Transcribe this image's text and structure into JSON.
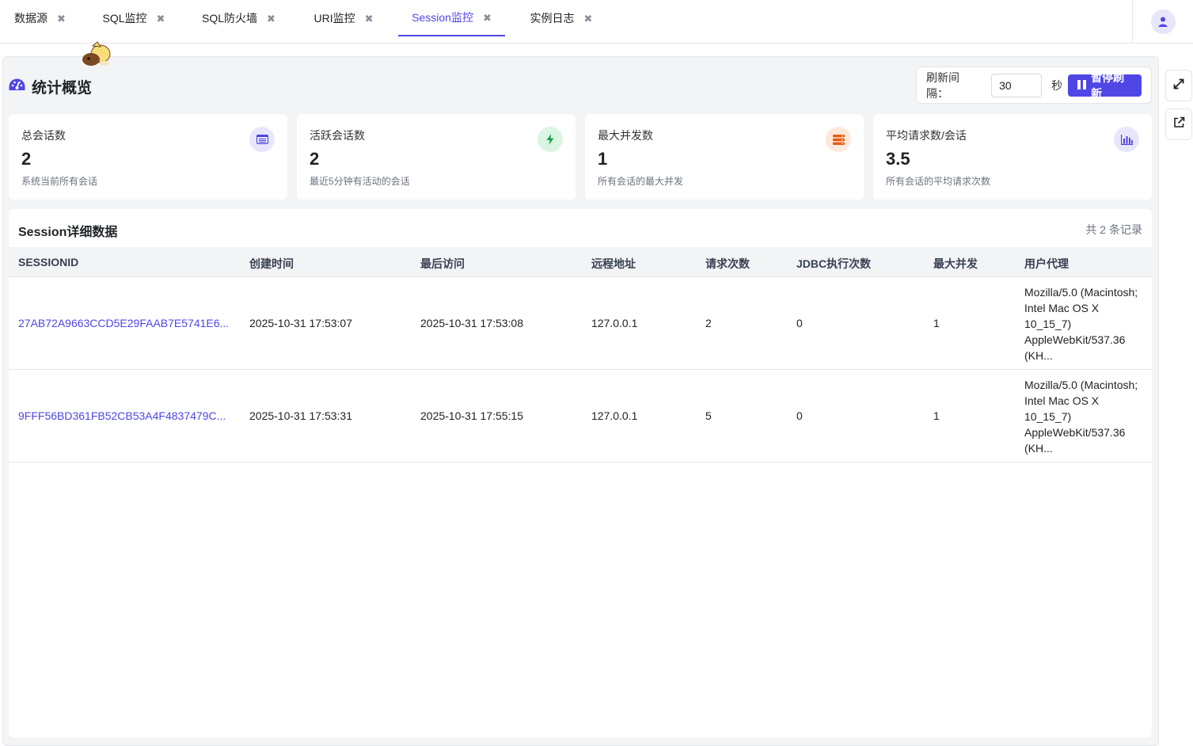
{
  "tabs": [
    {
      "label": "数据源",
      "active": false
    },
    {
      "label": "SQL监控",
      "active": false
    },
    {
      "label": "SQL防火墙",
      "active": false
    },
    {
      "label": "URI监控",
      "active": false
    },
    {
      "label": "Session监控",
      "active": true
    },
    {
      "label": "实例日志",
      "active": false
    }
  ],
  "tab_close_glyph": "✖",
  "overview": {
    "title": "统计概览",
    "icon": "gauge-icon",
    "refresh_label": "刷新间隔：",
    "refresh_value": "30",
    "refresh_unit": "秒",
    "pause_label": "暂停刷新"
  },
  "stats": [
    {
      "title": "总会话数",
      "value": "2",
      "desc": "系统当前所有会话",
      "icon": "list-icon",
      "icon_bg": "#e8e6fb",
      "icon_color": "#4f46e5"
    },
    {
      "title": "活跃会话数",
      "value": "2",
      "desc": "最近5分钟有活动的会话",
      "icon": "bolt-icon",
      "icon_bg": "#dcf5e3",
      "icon_color": "#16a34a"
    },
    {
      "title": "最大并发数",
      "value": "1",
      "desc": "所有会话的最大并发",
      "icon": "server-icon",
      "icon_bg": "#fde8dc",
      "icon_color": "#ea580c"
    },
    {
      "title": "平均请求数/会话",
      "value": "3.5",
      "desc": "所有会话的平均请求次数",
      "icon": "bar-chart-icon",
      "icon_bg": "#e8e6fb",
      "icon_color": "#4f46e5"
    }
  ],
  "table": {
    "title": "Session详细数据",
    "count": "共 2 条记录",
    "headers": [
      "SESSIONID",
      "创建时间",
      "最后访问",
      "远程地址",
      "请求次数",
      "JDBC执行次数",
      "最大并发",
      "用户代理"
    ],
    "rows": [
      [
        "27AB72A9663CCD5E29FAAB7E5741E6...",
        "2025-10-31 17:53:07",
        "2025-10-31 17:53:08",
        "127.0.0.1",
        "2",
        "0",
        "1",
        "Mozilla/5.0 (Macintosh; Intel Mac OS X 10_15_7) AppleWebKit/537.36 (KH..."
      ],
      [
        "9FFF56BD361FB52CB53A4F4837479C...",
        "2025-10-31 17:53:31",
        "2025-10-31 17:55:15",
        "127.0.0.1",
        "5",
        "0",
        "1",
        "Mozilla/5.0 (Macintosh; Intel Mac OS X 10_15_7) AppleWebKit/537.36 (KH..."
      ]
    ]
  },
  "colors": {
    "accent": "#4f46e5"
  }
}
